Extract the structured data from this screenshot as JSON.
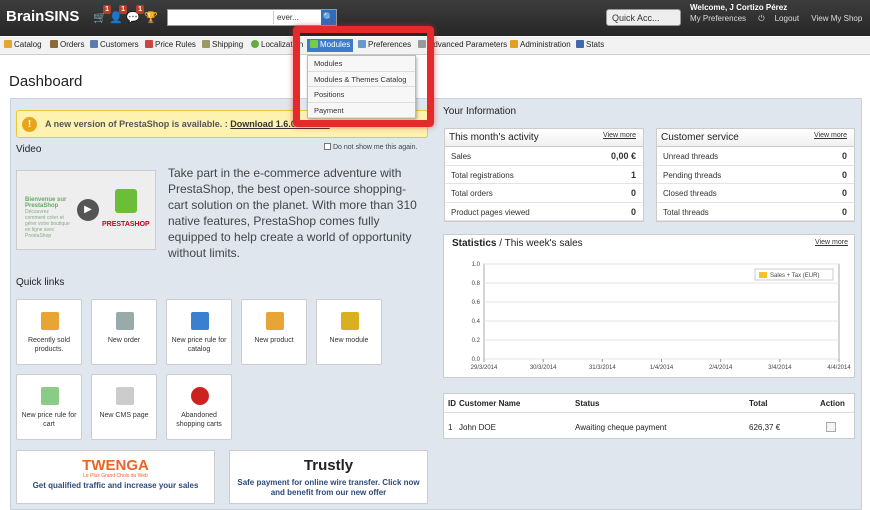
{
  "app": {
    "brand": "BrainSINS",
    "badges": [
      "1",
      "1",
      "1"
    ]
  },
  "search": {
    "value": "ever...",
    "button": "🔍"
  },
  "quick_access": "Quick Acc...",
  "user": {
    "welcome": "Welcome, J Cortizo Pérez",
    "links": [
      "My Preferences",
      "Logout",
      "View My Shop"
    ]
  },
  "tabs": [
    {
      "label": "Catalog",
      "color": "#e7a534"
    },
    {
      "label": "Orders",
      "color": "#8a6a3a"
    },
    {
      "label": "Customers",
      "color": "#5a7ab0"
    },
    {
      "label": "Price Rules",
      "color": "#c44"
    },
    {
      "label": "Shipping",
      "color": "#996"
    },
    {
      "label": "Localization",
      "color": "#6a4"
    },
    {
      "label": "Modules",
      "color": "#7c4"
    },
    {
      "label": "Preferences",
      "color": "#69c"
    },
    {
      "label": "Advanced Parameters",
      "color": "#999"
    },
    {
      "label": "Administration",
      "color": "#e0a020"
    },
    {
      "label": "Stats",
      "color": "#46a"
    }
  ],
  "modules_menu": [
    "Modules",
    "Modules & Themes Catalog",
    "Positions",
    "Payment"
  ],
  "page_title": "Dashboard",
  "update": {
    "text": "A new version of PrestaShop is available. :",
    "link": "Download 1.6.0 stable !",
    "icon": "!"
  },
  "video": {
    "label": "Video",
    "dont_show": "Do not show me this again.",
    "thumb_text": "Bienvenue sur PrestaShop",
    "thumb_sub": "Découvrez comment créer et gérer votre boutique en ligne avec PrestaShop",
    "thumb_brand": "PRESTASHOP",
    "promo": "Take part in the e-commerce adventure with PrestaShop, the best open-source shopping-cart solution on the planet. With more than 310 native features, PrestaShop comes fully equipped to help create a world of opportunity without limits."
  },
  "quick_links": {
    "title": "Quick links",
    "items": [
      {
        "label": "Recently sold products.",
        "color": "#e7a534"
      },
      {
        "label": "New order",
        "color": "#9aa"
      },
      {
        "label": "New price rule for catalog",
        "color": "#3a7fd0"
      },
      {
        "label": "New product",
        "color": "#e7a534"
      },
      {
        "label": "New module",
        "color": "#d8b020"
      },
      {
        "label": "New price rule for cart",
        "color": "#8c8"
      },
      {
        "label": "New CMS page",
        "color": "#ccc"
      },
      {
        "label": "Abandoned shopping carts",
        "color": "#c22"
      }
    ]
  },
  "partners": [
    {
      "logo": "TWENGA",
      "tag": "Le Plus Grand Choix du Web",
      "text": "Get qualified traffic and increase your sales",
      "color": "#e8662a"
    },
    {
      "logo": "Trustly",
      "text": "Safe payment for online wire transfer. Click now and benefit from our new offer",
      "color": "#3c3"
    }
  ],
  "info": {
    "title": "Your Information"
  },
  "activity": {
    "title": "This month's activity",
    "view_more": "View more",
    "rows": [
      {
        "label": "Sales",
        "value": "0,00 €"
      },
      {
        "label": "Total registrations",
        "value": "1"
      },
      {
        "label": "Total orders",
        "value": "0"
      },
      {
        "label": "Product pages viewed",
        "value": "0"
      }
    ]
  },
  "service": {
    "title": "Customer service",
    "view_more": "View more",
    "rows": [
      {
        "label": "Unread threads",
        "value": "0"
      },
      {
        "label": "Pending threads",
        "value": "0"
      },
      {
        "label": "Closed threads",
        "value": "0"
      },
      {
        "label": "Total threads",
        "value": "0"
      }
    ]
  },
  "stats": {
    "title_bold": "Statistics",
    "title_rest": " / This week's sales",
    "view_more": "View more"
  },
  "chart_data": {
    "type": "line",
    "x": [
      "29/3/2014",
      "30/3/2014",
      "31/3/2014",
      "1/4/2014",
      "2/4/2014",
      "3/4/2014",
      "4/4/2014"
    ],
    "series": [
      {
        "name": "Sales + Tax (EUR)",
        "values": []
      }
    ],
    "yticks": [
      "1.0",
      "0.8",
      "0.6",
      "0.4",
      "0.2",
      "0.0"
    ],
    "ylim": [
      0,
      1
    ],
    "legend": "top-right",
    "grid": true,
    "legend_color": "#f2c230"
  },
  "orders": {
    "headers": [
      "ID",
      "Customer Name",
      "Status",
      "Total",
      "Action"
    ],
    "rows": [
      {
        "id": "1",
        "customer": "John DOE",
        "status": "Awaiting cheque payment",
        "total": "626,37 €"
      }
    ]
  }
}
